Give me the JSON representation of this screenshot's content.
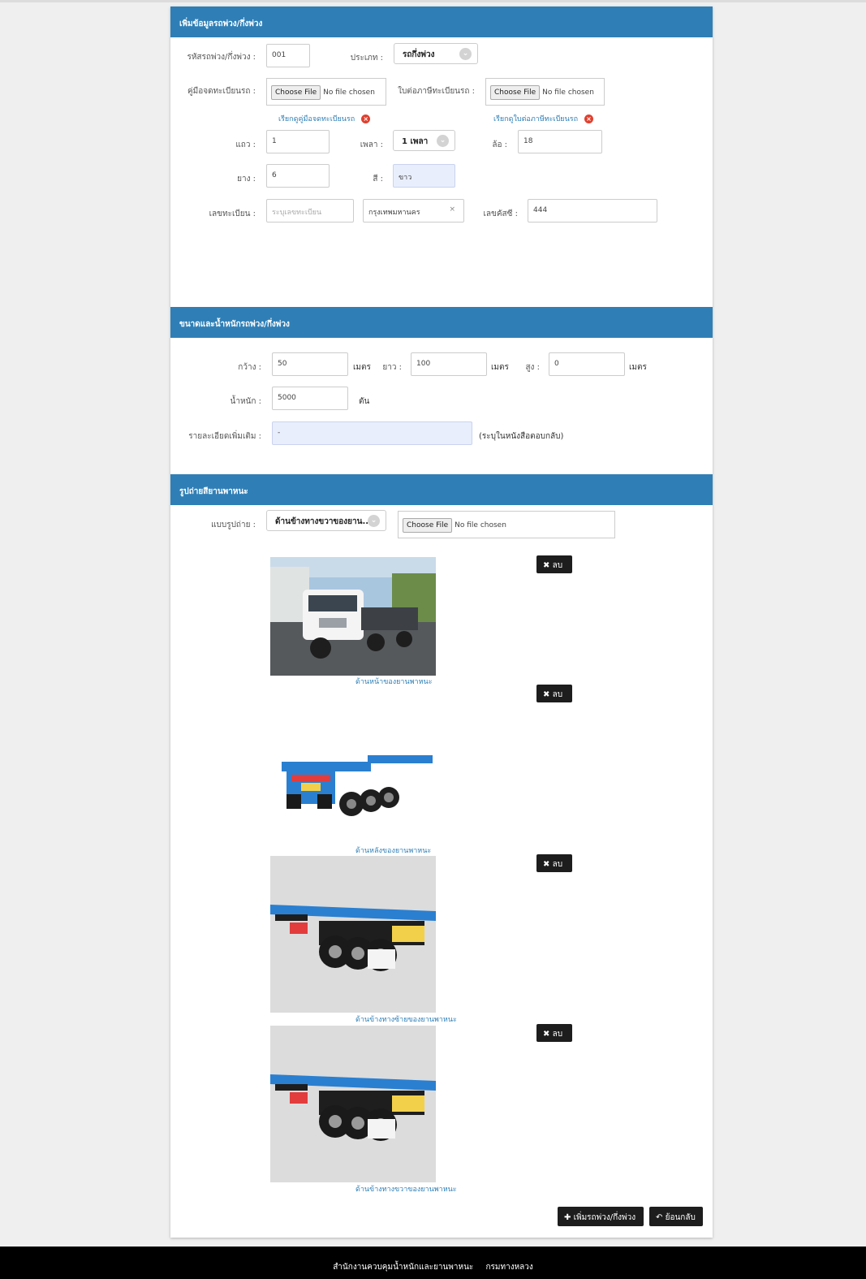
{
  "sections": {
    "info_title": "เพิ่มข้อมูลรถพ่วง/กึ่งพ่วง",
    "size_title": "ขนาดและน้ำหนักรถพ่วง/กึ่งพ่วง",
    "photo_title": "รูปถ่ายสียานพาหนะ"
  },
  "info": {
    "code_label": "รหัสรถพ่วง/กึ่งพ่วง :",
    "code_value": "001",
    "type_label": "ประเภท :",
    "type_value": "รถกึ่งพ่วง",
    "manual_label": "คู่มือจดทะเบียนรถ :",
    "tax_label": "ใบต่อภาษีทะเบียนรถ :",
    "file_button": "Choose File",
    "file_status": "No file chosen",
    "manual_link": "เรียกดูคู่มือจดทะเบียนรถ",
    "tax_link": "เรียกดูใบต่อภาษีทะเบียนรถ",
    "row_label": "แถว :",
    "row_value": "1",
    "axle_label": "เพลา :",
    "axle_value": "1 เพลา",
    "wheel_label": "ล้อ :",
    "wheel_value": "18",
    "tire_label": "ยาง :",
    "tire_value": "6",
    "color_label": "สี :",
    "color_value": "ขาว",
    "plate_label": "เลขทะเบียน :",
    "plate_placeholder": "ระบุเลขทะเบียน",
    "province_value": "กรุงเทพมหานคร",
    "province_clear": "×",
    "chassis_label": "เลขคัสซี :",
    "chassis_value": "444"
  },
  "size": {
    "width_label": "กว้าง :",
    "width_value": "50",
    "length_label": "ยาว :",
    "length_value": "100",
    "height_label": "สูง :",
    "height_value": "0",
    "unit_meter": "เมตร",
    "weight_label": "น้ำหนัก :",
    "weight_value": "5000",
    "weight_unit": "ตัน",
    "detail_label": "รายละเอียดเพิ่มเติม :",
    "detail_value": "-",
    "detail_note": "(ระบุในหนังสือตอบกลับ)"
  },
  "photos": {
    "type_label": "แบบรูปถ่าย :",
    "type_value": "ด้านข้างทางขวาของยาน...",
    "file_button": "Choose File",
    "file_status": "No file chosen",
    "delete_label": "ลบ",
    "items": [
      {
        "caption": "ด้านหน้าของยานพาหนะ"
      },
      {
        "caption": "ด้านหลังของยานพาหนะ"
      },
      {
        "caption": "ด้านข้างทางซ้ายของยานพาหนะ"
      },
      {
        "caption": "ด้านข้างทางขวาของยานพาหนะ"
      }
    ]
  },
  "actions": {
    "add_label": "เพิ่มรถพ่วง/กึ่งพ่วง",
    "back_label": "ย้อนกลับ"
  },
  "footer": {
    "org": "สำนักงานควบคุมน้ำหนักและยานพาหนะ",
    "dept": "กรมทางหลวง"
  },
  "colors": {
    "header_blue": "#2f7fb6",
    "link_blue": "#2f7fb6",
    "trailer_blue": "#2a7fd0"
  }
}
